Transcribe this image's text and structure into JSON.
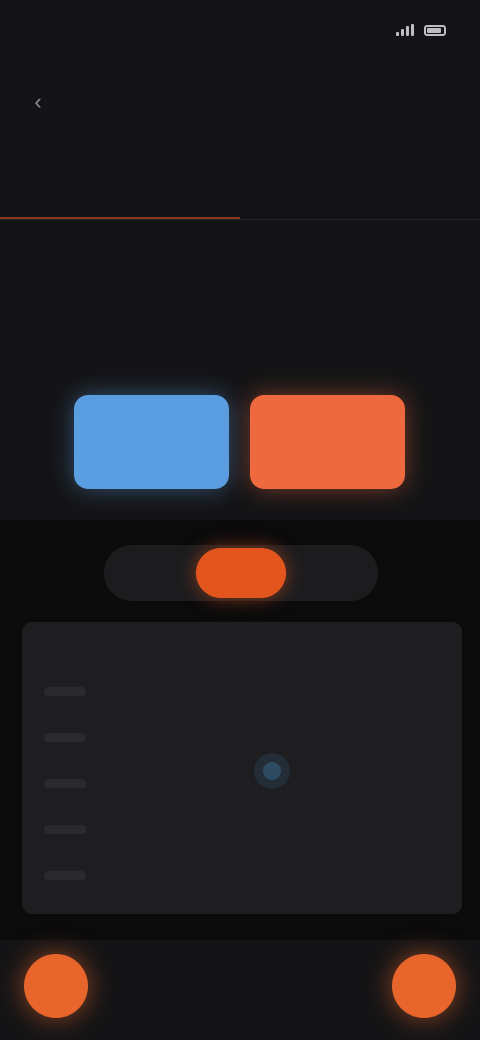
{
  "status_bar": {
    "time": "",
    "battery_icon": "battery-icon",
    "signal_icon": "signal-icon"
  },
  "header": {
    "title": "",
    "back_icon": "chevron-left-icon"
  },
  "tabs": [
    {
      "label": "",
      "active": true
    },
    {
      "label": "",
      "active": false
    }
  ],
  "reading": {
    "label": "",
    "value": "",
    "unit": ""
  },
  "actions": {
    "primary_label": "",
    "accent_label": ""
  },
  "segments": [
    {
      "label": "",
      "active": false
    },
    {
      "label": "",
      "active": true
    },
    {
      "label": "",
      "active": false
    }
  ],
  "chart_data": {
    "type": "scatter",
    "y_tick_labels": [
      "",
      "",
      "",
      "",
      ""
    ],
    "points": [
      {
        "x": 0.5,
        "y": 0.55
      }
    ],
    "point_color": "#2f4b63",
    "grid": false
  },
  "bottom_bar": {
    "left_icon": "plus-icon",
    "right_icon": "plus-icon",
    "accent_color": "#e8652b"
  },
  "colors": {
    "primary": "#5a9de0",
    "accent": "#ee6a3e",
    "segment_active": "#e2561e",
    "tab_indicator": "#8a3a22"
  }
}
